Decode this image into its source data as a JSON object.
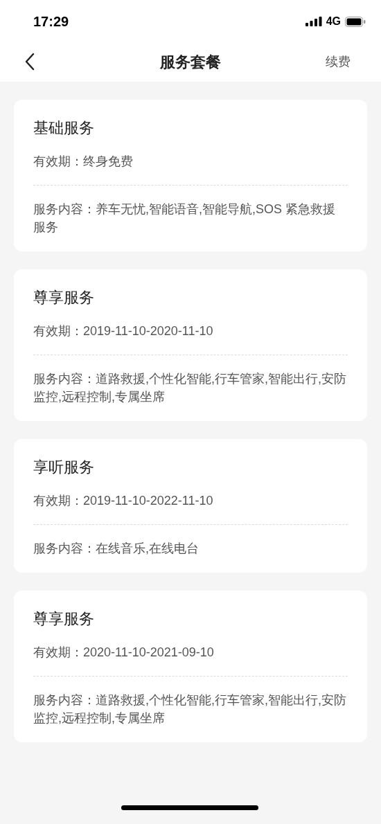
{
  "status_bar": {
    "time": "17:29",
    "network": "4G"
  },
  "nav": {
    "title": "服务套餐",
    "action": "续费"
  },
  "packages": [
    {
      "title": "基础服务",
      "validity": "有效期：终身免费",
      "content": "服务内容：养车无忧,智能语音,智能导航,SOS 紧急救援服务"
    },
    {
      "title": "尊享服务",
      "validity": "有效期：2019-11-10-2020-11-10",
      "content": "服务内容：道路救援,个性化智能,行车管家,智能出行,安防监控,远程控制,专属坐席"
    },
    {
      "title": "享听服务",
      "validity": "有效期：2019-11-10-2022-11-10",
      "content": "服务内容：在线音乐,在线电台"
    },
    {
      "title": "尊享服务",
      "validity": "有效期：2020-11-10-2021-09-10",
      "content": "服务内容：道路救援,个性化智能,行车管家,智能出行,安防监控,远程控制,专属坐席"
    }
  ]
}
